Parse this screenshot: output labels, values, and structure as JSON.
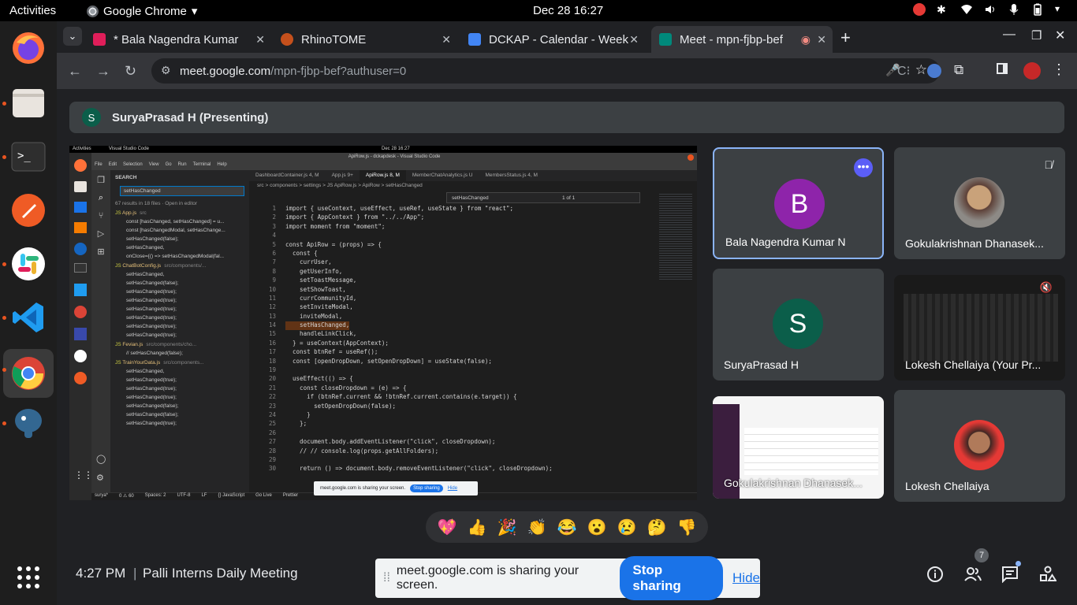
{
  "topbar": {
    "activities": "Activities",
    "app": "Google Chrome",
    "clock": "Dec 28  16:27"
  },
  "dock": [
    "firefox-icon",
    "files-icon",
    "terminal-icon",
    "postman-icon",
    "slack-icon",
    "vscode-icon",
    "chrome-icon",
    "pgadmin-icon"
  ],
  "tabs": [
    {
      "label": "* Bala Nagendra Kumar",
      "color": "#e01e5a"
    },
    {
      "label": "RhinoTOME",
      "color": "#c5501c"
    },
    {
      "label": "DCKAP - Calendar - Week",
      "color": "#4285f4"
    },
    {
      "label": "Meet - mpn-fjbp-bef",
      "color": "#00897b"
    }
  ],
  "address": {
    "host": "meet.google.com",
    "path": "/mpn-fjbp-bef?authuser=0"
  },
  "presenting": {
    "initial": "S",
    "label": "SuryaPrasad H (Presenting)"
  },
  "shared_screen": {
    "top": "Activities",
    "app": "Visual Studio Code",
    "clock": "Dec 28  16:27",
    "title": "ApiRow.js - dckapdesk - Visual Studio Code",
    "menu": [
      "File",
      "Edit",
      "Selection",
      "View",
      "Go",
      "Run",
      "Terminal",
      "Help"
    ],
    "search_title": "SEARCH",
    "search_query": "setHasChanged",
    "results": "67 results in 18 files · Open in editor",
    "files": [
      {
        "name": "App.js",
        "path": "src",
        "lines": [
          "const [hasChanged, setHasChanged] = u...",
          "const [hasChangedModal, setHasChange...",
          "setHasChanged(false);",
          "setHasChanged,",
          "onClose={() => setHasChangedModal(fal..."
        ]
      },
      {
        "name": "ChatBotConfig.js",
        "path": "src/components/...",
        "lines": [
          "setHasChanged,",
          "setHasChanged(false);",
          "setHasChanged(true);",
          "setHasChanged(true);",
          "setHasChanged(true);",
          "setHasChanged(true);",
          "setHasChanged(true);",
          "setHasChanged(true);"
        ]
      },
      {
        "name": "Fevian.js",
        "path": "src/components/cho...",
        "lines": [
          "// setHasChanged(false);"
        ]
      },
      {
        "name": "TrainYourData.js",
        "path": "src/components...",
        "lines": [
          "setHasChanged,",
          "setHasChanged(true);",
          "setHasChanged(true);",
          "setHasChanged(true);",
          "setHasChanged(false);",
          "setHasChanged(false);",
          "setHasChanged(true);"
        ]
      }
    ],
    "editor_tabs": [
      "DashboardContainer.js 4, M",
      "App.js 9+",
      "ApiRow.js 8, M",
      "MemberChatAnalytics.js U",
      "MembersStatus.js 4, M"
    ],
    "breadcrumb": "src > components > settings > JS ApiRow.js > ApiRow > setHasChanged",
    "find": "setHasChanged",
    "find_count": "1 of 1",
    "code": [
      "import { useContext, useEffect, useRef, useState } from \"react\";",
      "import { AppContext } from \"../../App\";",
      "import moment from \"moment\";",
      "",
      "const ApiRow = (props) => {",
      "  const {",
      "    currUser,",
      "    getUserInfo,",
      "    setToastMessage,",
      "    setShowToast,",
      "    currCommunityId,",
      "    setInviteModal,",
      "    inviteModal,",
      "    setHasChanged,",
      "    handleLinkClick,",
      "  } = useContext(AppContext);",
      "  const btnRef = useRef();",
      "  const [openDropDown, setOpenDropDown] = useState(false);",
      "",
      "  useEffect(() => {",
      "    const closeDropdown = (e) => {",
      "      if (btnRef.current && !btnRef.current.contains(e.target)) {",
      "        setOpenDropDown(false);",
      "      }",
      "    };",
      "",
      "    document.body.addEventListener(\"click\", closeDropdown);",
      "    // // console.log(props.getAllFolders);",
      "",
      "    return () => document.body.removeEventListener(\"click\", closeDropdown);"
    ],
    "status": [
      "surya*",
      "0 ⚠ 60",
      "Spaces: 2",
      "UTF-8",
      "LF",
      "{} JavaScript",
      "Go Live",
      "Prettier"
    ],
    "mini_share": "meet.google.com is sharing your screen.",
    "mini_stop": "Stop sharing",
    "mini_hide": "Hide"
  },
  "participants": [
    {
      "name": "Bala Nagendra Kumar N",
      "initial": "B",
      "color": "#8e24aa"
    },
    {
      "name": "Gokulakrishnan Dhanasek...",
      "initial": ""
    },
    {
      "name": "SuryaPrasad H",
      "initial": "S",
      "color": "#0b5e4a"
    },
    {
      "name": "Lokesh Chellaiya (Your Pr...",
      "initial": ""
    },
    {
      "name": "Gokulakrishnan Dhanasek...",
      "initial": ""
    },
    {
      "name": "Lokesh Chellaiya",
      "initial": ""
    }
  ],
  "reactions": [
    "💖",
    "👍",
    "🎉",
    "👏",
    "😂",
    "😮",
    "😢",
    "🤔",
    "👎"
  ],
  "bottom": {
    "time": "4:27 PM",
    "sep": "|",
    "meeting": "Palli Interns Daily Meeting",
    "people_count": "7"
  },
  "sharebar": {
    "text": "meet.google.com is sharing your screen.",
    "stop": "Stop sharing",
    "hide": "Hide"
  }
}
